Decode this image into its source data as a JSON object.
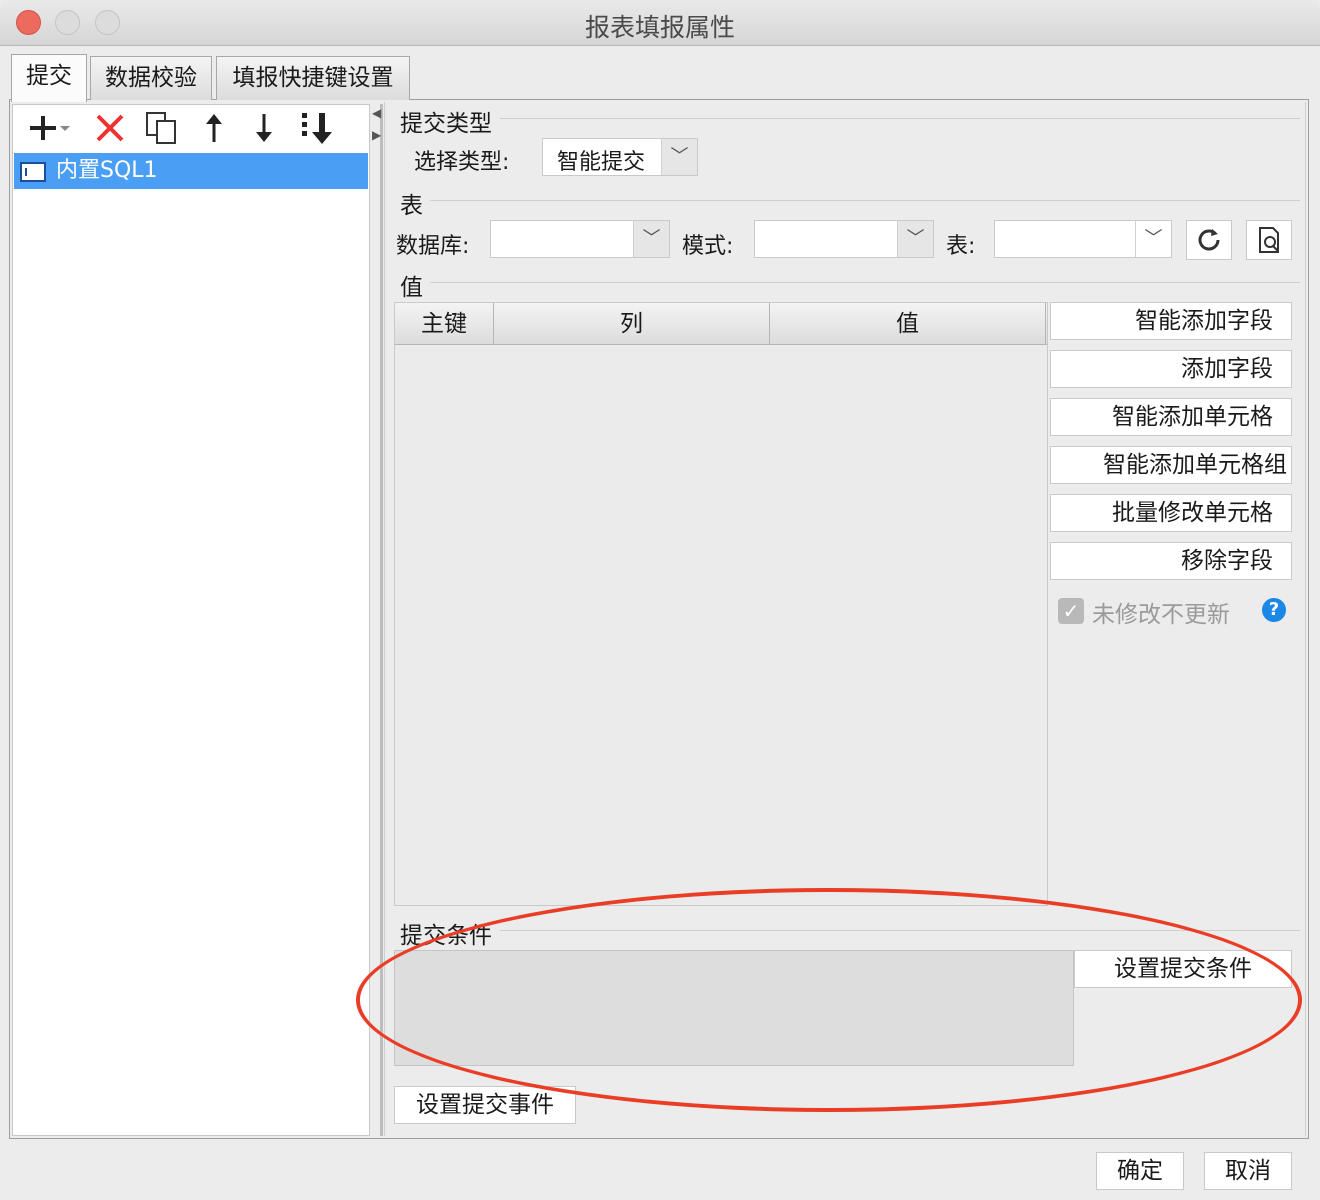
{
  "window": {
    "title": "报表填报属性"
  },
  "tabs": [
    {
      "label": "提交",
      "active": true
    },
    {
      "label": "数据校验",
      "active": false
    },
    {
      "label": "填报快捷键设置",
      "active": false
    }
  ],
  "toolbar": {
    "add_icon": "plus-icon",
    "delete_icon": "delete-icon",
    "copy_icon": "copy-icon",
    "up_icon": "move-up-icon",
    "down_icon": "move-down-icon",
    "bottom_icon": "move-to-bottom-icon"
  },
  "tree": {
    "items": [
      {
        "label": "内置SQL1",
        "selected": true
      }
    ]
  },
  "submit_type": {
    "section_title": "提交类型",
    "select_label": "选择类型:",
    "select_value": "智能提交"
  },
  "table_section": {
    "section_title": "表",
    "database_label": "数据库:",
    "database_value": "",
    "schema_label": "模式:",
    "schema_value": "",
    "table_label": "表:",
    "table_value": ""
  },
  "value_section": {
    "section_title": "值",
    "columns": [
      "主键",
      "列",
      "值"
    ],
    "rows": []
  },
  "side_buttons": {
    "smart_add_field": "智能添加字段",
    "add_field": "添加字段",
    "smart_add_cell": "智能添加单元格",
    "smart_add_cell_group": "智能添加单元格组",
    "batch_modify_cell": "批量修改单元格",
    "remove_field": "移除字段"
  },
  "no_update_unchanged": {
    "label": "未修改不更新",
    "checked": true,
    "disabled": true
  },
  "submit_condition": {
    "section_title": "提交条件",
    "set_button": "设置提交条件"
  },
  "set_submit_event_button": "设置提交事件",
  "footer": {
    "ok": "确定",
    "cancel": "取消"
  },
  "colors": {
    "selection": "#4a9ff5",
    "annotation": "#ea3d26",
    "help": "#1b87e6"
  }
}
